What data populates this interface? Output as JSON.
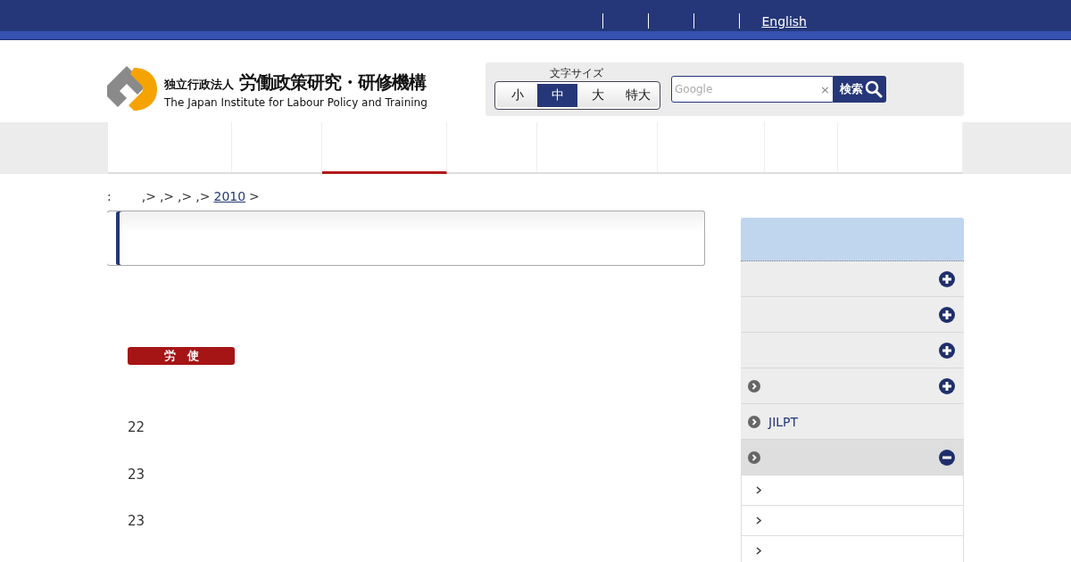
{
  "top_links": [
    {
      "kind": "separator"
    },
    {
      "kind": "separator"
    },
    {
      "kind": "separator"
    },
    {
      "kind": "separator"
    },
    {
      "kind": "link",
      "label": "English"
    }
  ],
  "logo": {
    "org_type": "独立行政法人",
    "name": "労働政策研究・研修機構",
    "name_en": "The Japan Institute for Labour Policy and Training"
  },
  "font_size": {
    "label": "文字サイズ",
    "options": [
      {
        "label": "小",
        "selected": false
      },
      {
        "label": "中",
        "selected": true
      },
      {
        "label": "大",
        "selected": false
      },
      {
        "label": "特大",
        "selected": false
      }
    ]
  },
  "search": {
    "placeholder": "Google",
    "clear": "×",
    "button": "検索"
  },
  "nav_tabs": [
    {
      "selected": false
    },
    {
      "selected": false
    },
    {
      "selected": true
    },
    {
      "selected": false
    },
    {
      "selected": false
    },
    {
      "selected": false
    },
    {
      "selected": false
    },
    {
      "selected": false
    }
  ],
  "breadcrumb": [
    {
      "kind": "text",
      "text": ":"
    },
    {
      "kind": "text",
      "text": ",>"
    },
    {
      "kind": "text",
      "text": ",>"
    },
    {
      "kind": "text",
      "text": ",>"
    },
    {
      "kind": "text",
      "text": ",>"
    },
    {
      "kind": "link",
      "text": "2010"
    },
    {
      "kind": "text",
      "text": ">"
    }
  ],
  "badge": "労　使",
  "numbers": [
    "22",
    "23",
    "23"
  ],
  "sidebar": {
    "items": [
      {
        "kind": "group",
        "expanded": false
      },
      {
        "kind": "group",
        "expanded": false
      },
      {
        "kind": "group",
        "expanded": false
      },
      {
        "kind": "arrow-group",
        "expanded": false
      },
      {
        "kind": "link",
        "label": "JILPT"
      },
      {
        "kind": "arrow-group",
        "expanded": true
      },
      {
        "kind": "sub"
      },
      {
        "kind": "sub"
      },
      {
        "kind": "sub"
      }
    ]
  }
}
